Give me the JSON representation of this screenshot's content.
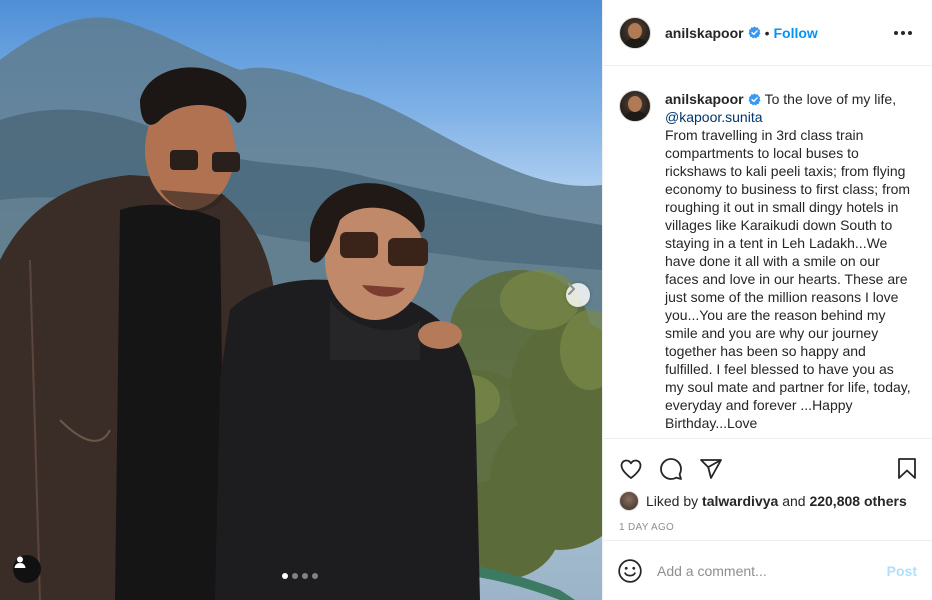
{
  "post": {
    "username": "anilskapoor",
    "follow_label": "Follow",
    "separator": "•",
    "caption_mention": "@kapoor.sunita",
    "caption_intro": "To the love of my life,",
    "caption_body": "From travelling in 3rd class train compartments to local buses to rickshaws to kali peeli taxis; from flying economy to business to first class; from roughing it out in small dingy hotels in villages like Karaikudi down South to staying in a tent in Leh Ladakh...We have done it all with a smile on our faces and love in our hearts. These are just some of the million reasons I love you...You are the reason behind my smile and you are why our journey together has been so happy and fulfilled. I feel blessed to have you as my soul mate and partner for life, today, everyday and forever ...Happy Birthday...Love",
    "heart_glyph": "❤"
  },
  "carousel": {
    "slide_count": 4,
    "active_index": 0
  },
  "likes": {
    "prefix": "Liked by",
    "liker": "talwardivya",
    "conjunction": "and",
    "others": "220,808 others"
  },
  "timestamp": "1 DAY AGO",
  "comment": {
    "placeholder": "Add a comment...",
    "post_label": "Post"
  },
  "colors": {
    "link_blue": "#0095f6",
    "post_disabled": "#b2dffc",
    "verified_blue": "#3897f0"
  },
  "icons": {
    "like": "heart-icon",
    "comment": "comment-icon",
    "share": "paper-plane-icon",
    "save": "bookmark-icon",
    "more": "more-options-icon",
    "next": "chevron-right-icon",
    "tag": "user-tag-icon",
    "emoji": "emoji-icon"
  }
}
